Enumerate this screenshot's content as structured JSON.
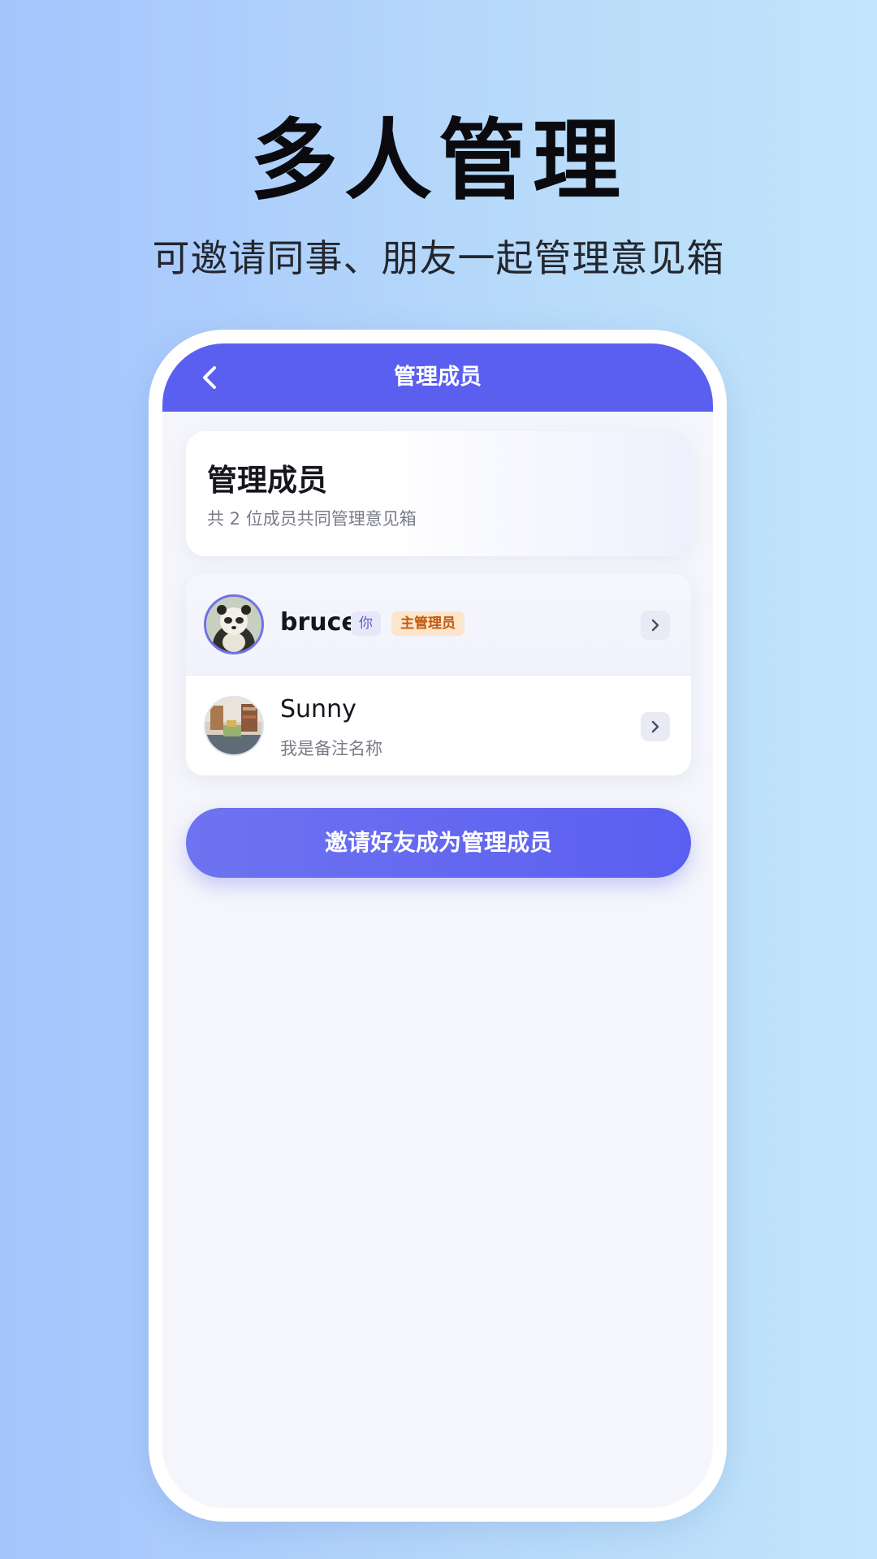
{
  "hero": {
    "title": "多人管理",
    "subtitle": "可邀请同事、朋友一起管理意见箱"
  },
  "app_bar": {
    "back_icon": "chevron-left-icon",
    "title": "管理成员"
  },
  "info_card": {
    "title": "管理成员",
    "description": "共 2 位成员共同管理意见箱"
  },
  "members": [
    {
      "name": "bruce",
      "you_badge": "你",
      "role_badge": "主管理员",
      "avatar": "panda-avatar"
    },
    {
      "name": "Sunny",
      "remark": "我是备注名称",
      "avatar": "room-photo-avatar"
    }
  ],
  "invite_button": "邀请好友成为管理成员",
  "colors": {
    "accent": "#5b5ff0",
    "background": "#f5f6fb",
    "admin_badge_text": "#c25a12",
    "admin_badge_bg": "#fde5cb"
  }
}
